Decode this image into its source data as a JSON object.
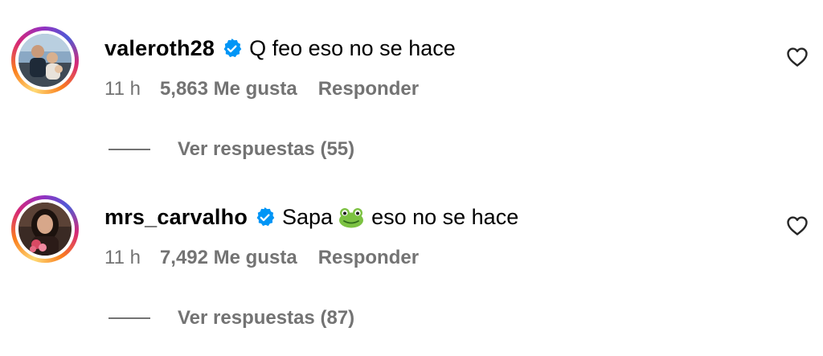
{
  "colors": {
    "text_primary": "#000000",
    "text_secondary": "#737373",
    "verified_blue": "#0095f6"
  },
  "comments": [
    {
      "username": "valeroth28",
      "verified_icon": "verified-badge-icon",
      "text": "Q feo eso no se hace",
      "time": "11 h",
      "likes": "5,863 Me gusta",
      "reply_label": "Responder",
      "view_replies": "Ver respuestas (55)",
      "like_icon": "heart-outline-icon"
    },
    {
      "username": "mrs_carvalho",
      "verified_icon": "verified-badge-icon",
      "text_before": "Sapa",
      "emoji": "frog-emoji",
      "text_after": "eso no se hace",
      "time": "11 h",
      "likes": "7,492 Me gusta",
      "reply_label": "Responder",
      "view_replies": "Ver respuestas (87)",
      "like_icon": "heart-outline-icon"
    }
  ]
}
